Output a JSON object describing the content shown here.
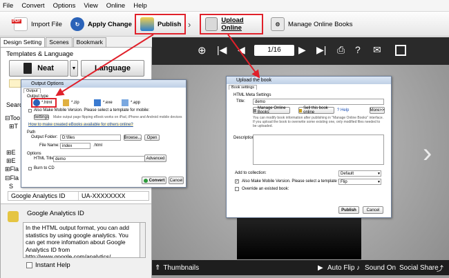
{
  "menu": [
    "File",
    "Convert",
    "Options",
    "View",
    "Online",
    "Help"
  ],
  "toolbar": {
    "import_file": "Import File",
    "apply_change": "Apply Change",
    "publish": "Publish",
    "upload_online": "Upload Online",
    "manage_online_books": "Manage Online Books",
    "pdf_badge": "PDF"
  },
  "left": {
    "tabs": [
      "Design Setting",
      "Scenes",
      "Bookmark"
    ],
    "templates_label": "Templates & Language",
    "neat_button": "Neat",
    "language_button": "Language",
    "sidebar_fragments": [
      "Searc",
      "Too",
      "T",
      "E",
      "E",
      "Fla",
      "Fla",
      "S"
    ],
    "ga_label": "Google Analytics ID",
    "ga_value": "UA-XXXXXXXX",
    "help_title": "Google Analytics ID",
    "help_text": "In the HTML output format, you can add statistics by using google analytics. You can get more infomation about Google Analytics ID from http://www.google.com/analytics/",
    "instant_help": "Instant Help"
  },
  "viewer": {
    "page_indicator": "1/16",
    "thumbnails": "Thumbnails",
    "auto_flip": "Auto Flip",
    "sound_on": "Sound On",
    "social_share": "Social Share"
  },
  "output_dialog": {
    "title": "Output Options",
    "tab": "Output",
    "output_type": "Output type",
    "type_html": "*.html",
    "type_zip": "*.zip",
    "type_exe": "*.exe",
    "type_app": "*.app",
    "mobile_check": "Also Make Mobile Version. Please select a template for mobile:",
    "settings": "Settings",
    "note": "Make output page flipping eBook works on iPad, iPhone and Android mobile devices",
    "link": "How to make created eBooks available for others online?",
    "path": "Path",
    "output_folder_label": "Output Folder:",
    "output_folder_value": "D:\\files",
    "file_name_label": "File Name:",
    "file_name_value": "index",
    "ext": ".html",
    "browse": "Browse...",
    "open": "Open",
    "options": "Options",
    "html_title_label": "HTML Title:",
    "html_title_value": "demo",
    "advanced": "Advanced",
    "burn_cd": "Burn to CD",
    "convert": "Convert",
    "cancel": "Cancel"
  },
  "upload_dialog": {
    "title": "Upload the book",
    "tab": "Book settings",
    "section": "HTML Meta Settings",
    "title_label": "Title:",
    "title_value": "demo",
    "manage_btn": "Manage Online Books",
    "sell_btn": "Sell this book online",
    "help": "Help",
    "more": "More>>",
    "note": "You can modify book information after publishing in \"Manage Online Books\" interface. If you upload the book to overwrite some existing one, only modified files needed to be uploaded.",
    "description_label": "Description:",
    "add_collection_label": "Add to collection:",
    "add_collection_value": "Default",
    "mobile_check": "Also Make Mobile Version. Please select a template for mobile:",
    "mobile_value": "Flip",
    "override_check": "Override an existed book:",
    "publish": "Publish",
    "cancel": "Cancel"
  },
  "colors": {
    "highlight": "#e0202a",
    "viewer_bg": "#9a9a9a",
    "bar_dark": "#1e1e1e"
  }
}
